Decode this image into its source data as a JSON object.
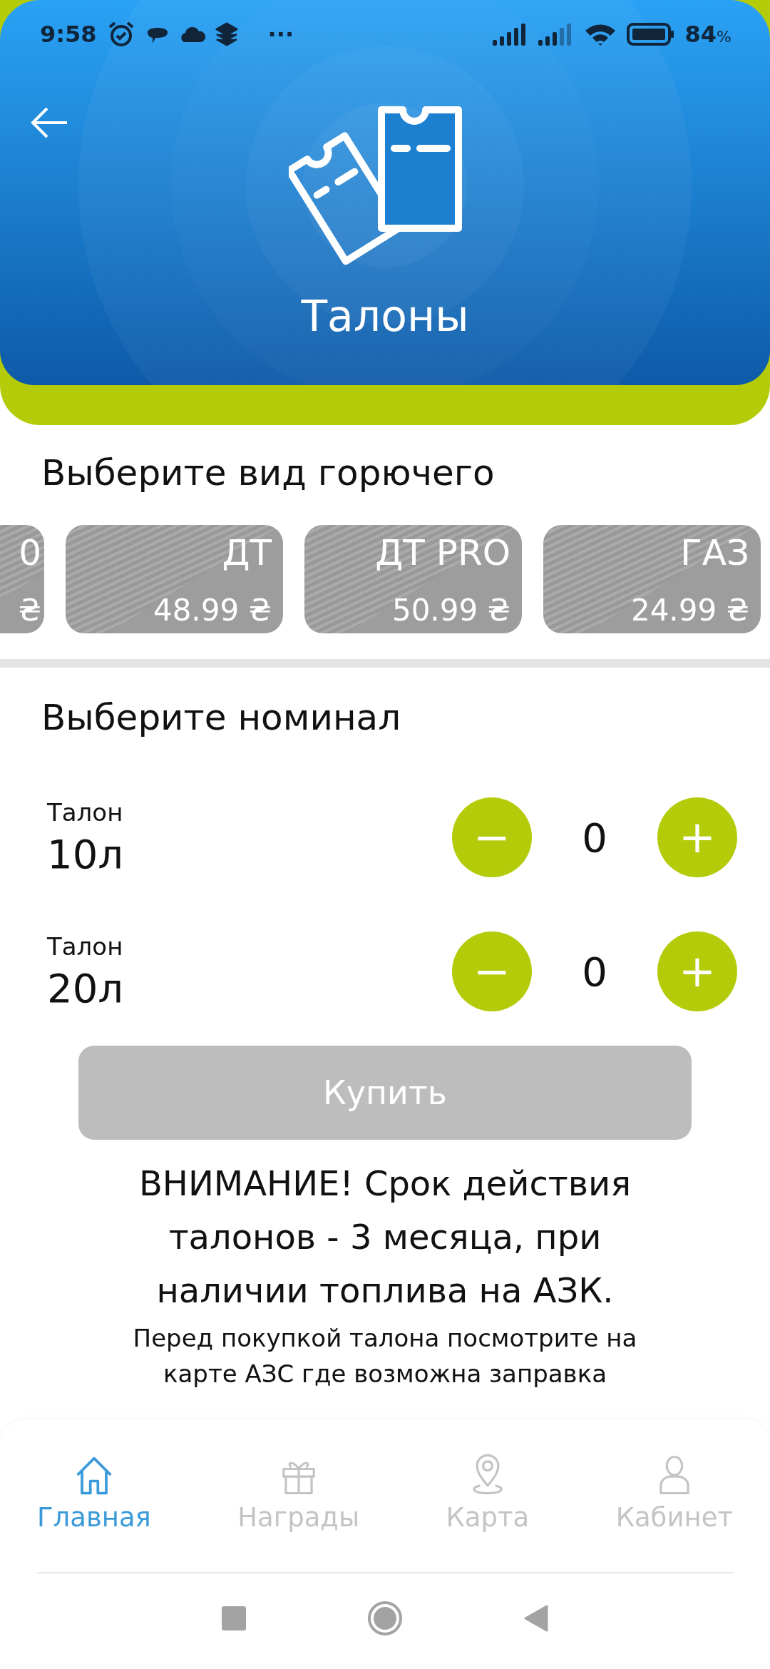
{
  "status_bar": {
    "time": "9:58",
    "more": "···",
    "battery": "84",
    "battery_unit": "%"
  },
  "header": {
    "title": "Талоны"
  },
  "fuel_section": {
    "title": "Выберите вид горючего",
    "fuels": [
      {
        "name": "0",
        "price": "₴",
        "partial": true
      },
      {
        "name": "ДТ",
        "price": "48.99 ₴",
        "partial": false
      },
      {
        "name": "ДТ PRO",
        "price": "50.99 ₴",
        "partial": false
      },
      {
        "name": "ГАЗ",
        "price": "24.99 ₴",
        "partial": false
      }
    ]
  },
  "nominal_section": {
    "title": "Выберите номинал",
    "items": [
      {
        "label": "Талон",
        "volume": "10л",
        "count": "0",
        "minus": "−",
        "plus": "+"
      },
      {
        "label": "Талон",
        "volume": "20л",
        "count": "0",
        "minus": "−",
        "plus": "+"
      }
    ]
  },
  "buy_button": {
    "label": "Купить",
    "disabled": true
  },
  "notice": {
    "warning": "ВНИМАНИЕ! Срок действия талонов - 3 месяца, при наличии топлива на АЗК.",
    "hint": "Перед покупкой талона посмотрите на карте АЗС где возможна заправка"
  },
  "bottom_nav": [
    {
      "kind": "home",
      "label": "Главная",
      "selected": true
    },
    {
      "kind": "gift",
      "label": "Награды",
      "selected": false
    },
    {
      "kind": "map",
      "label": "Карта",
      "selected": false
    },
    {
      "kind": "profile",
      "label": "Кабинет",
      "selected": false
    }
  ]
}
